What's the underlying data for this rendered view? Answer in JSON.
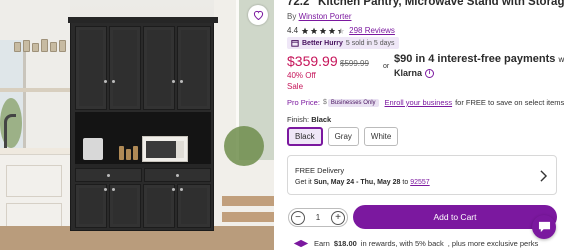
{
  "product": {
    "title": "72.2\" Kitchen Pantry, Microwave Stand with Storage",
    "by_prefix": "By",
    "brand": "Winston Porter",
    "rating": "4.4",
    "stars_value": 4.4,
    "stars_max": 5,
    "reviews": "298 Reviews",
    "hurry_label": "Better Hurry",
    "hurry_sold": "5 sold in 5 days",
    "wishlist_icon": "heart-icon"
  },
  "pricing": {
    "price": "$359.99",
    "old_price": "$599.99",
    "discount": "40% Off",
    "sale": "Sale",
    "or": "or",
    "klarna_amount": "$90",
    "klarna_text": "in 4 interest-free payments",
    "klarna_with": "with",
    "klarna_brand": "Klarna",
    "info_glyph": "i"
  },
  "pro": {
    "label": "Pro Price:",
    "price_char": "$",
    "badge": "Businesses Only",
    "enroll_link": "Enroll your business",
    "rest": "for FREE to save on select items."
  },
  "finish": {
    "label": "Finish:",
    "selected": "Black",
    "options": [
      "Black",
      "Gray",
      "White"
    ]
  },
  "delivery": {
    "title": "FREE Delivery",
    "date_prefix": "Get it",
    "date_range": "Sun, May 24 - Thu, May 28",
    "to": "to",
    "zip": "92557"
  },
  "cart": {
    "minus": "−",
    "quantity": "1",
    "plus": "+",
    "add_label": "Add to Cart"
  },
  "rewards": {
    "prefix": "Earn",
    "amount": "$18.00",
    "text": "in rewards, with 5% back",
    "suffix": ", plus more exclusive perks"
  },
  "colors": {
    "brand_purple": "#7b189f",
    "sale_red": "#c6155a",
    "badge_bg": "#efe7f7"
  }
}
